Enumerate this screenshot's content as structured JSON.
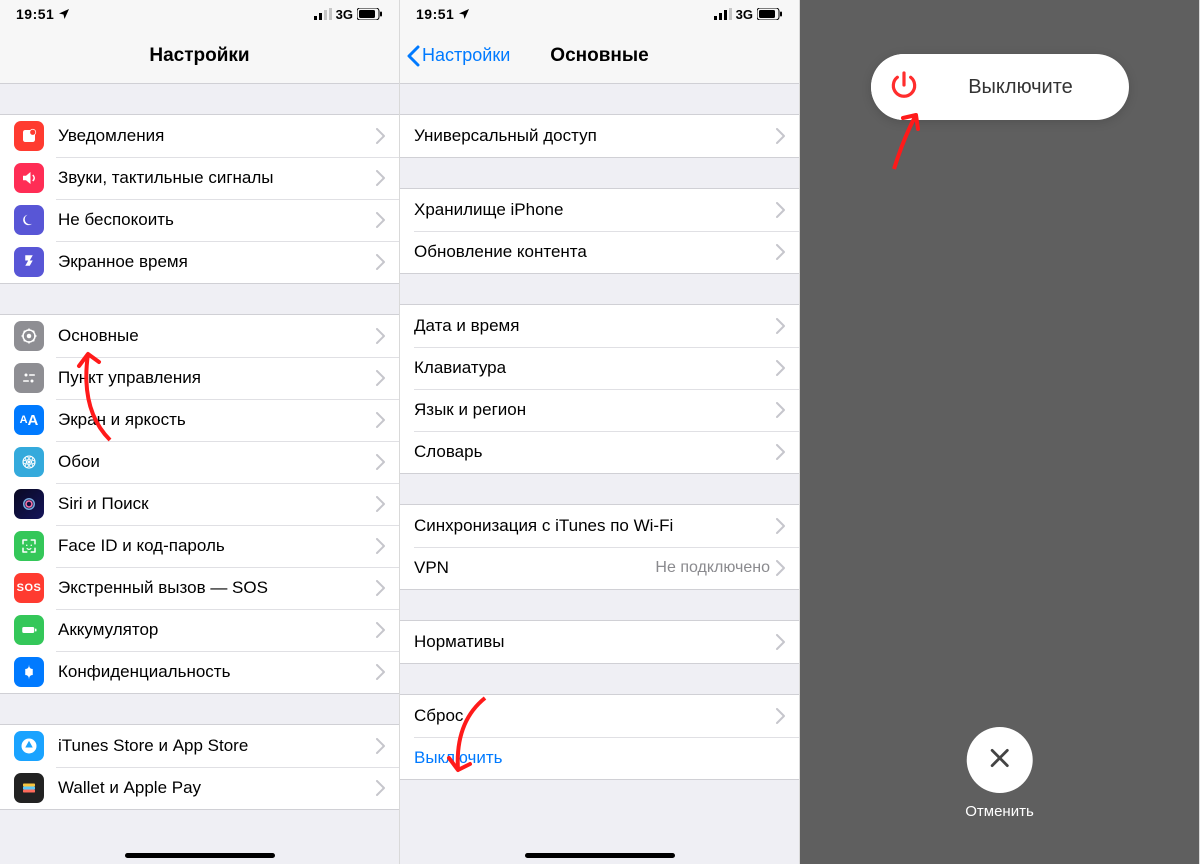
{
  "statusbar": {
    "time": "19:51",
    "network": "3G"
  },
  "screen1": {
    "title": "Настройки",
    "group_a": [
      {
        "icon": "notifications-icon",
        "color": "ic-red",
        "label": "Уведомления"
      },
      {
        "icon": "sounds-icon",
        "color": "ic-red2",
        "label": "Звуки, тактильные сигналы"
      },
      {
        "icon": "dnd-icon",
        "color": "ic-purple",
        "label": "Не беспокоить"
      },
      {
        "icon": "screentime-icon",
        "color": "ic-hourg",
        "label": "Экранное время"
      }
    ],
    "group_b": [
      {
        "icon": "general-icon",
        "color": "ic-gray",
        "label": "Основные"
      },
      {
        "icon": "controlcenter-icon",
        "color": "ic-gray2",
        "label": "Пункт управления"
      },
      {
        "icon": "display-icon",
        "color": "ic-blue",
        "label": "Экран и яркость"
      },
      {
        "icon": "wallpaper-icon",
        "color": "ic-cyan",
        "label": "Обои"
      },
      {
        "icon": "siri-icon",
        "color": "ic-siri",
        "label": "Siri и Поиск"
      },
      {
        "icon": "faceid-icon",
        "color": "ic-green",
        "label": "Face ID и код-пароль"
      },
      {
        "icon": "sos-icon",
        "color": "ic-sos",
        "label": "Экстренный вызов — SOS"
      },
      {
        "icon": "battery-icon",
        "color": "ic-green2",
        "label": "Аккумулятор"
      },
      {
        "icon": "privacy-icon",
        "color": "ic-hand",
        "label": "Конфиденциальность"
      }
    ],
    "group_c": [
      {
        "icon": "appstore-icon",
        "color": "ic-appst",
        "label": "iTunes Store и App Store"
      },
      {
        "icon": "wallet-icon",
        "color": "ic-wallet",
        "label": "Wallet и Apple Pay"
      }
    ]
  },
  "screen2": {
    "back": "Настройки",
    "title": "Основные",
    "group_a": [
      {
        "label": "Универсальный доступ"
      }
    ],
    "group_b": [
      {
        "label": "Хранилище iPhone"
      },
      {
        "label": "Обновление контента"
      }
    ],
    "group_c": [
      {
        "label": "Дата и время"
      },
      {
        "label": "Клавиатура"
      },
      {
        "label": "Язык и регион"
      },
      {
        "label": "Словарь"
      }
    ],
    "group_d": [
      {
        "label": "Синхронизация с iTunes по Wi-Fi"
      },
      {
        "label": "VPN",
        "value": "Не подключено"
      }
    ],
    "group_e": [
      {
        "label": "Нормативы"
      }
    ],
    "group_f": [
      {
        "label": "Сброс"
      },
      {
        "label": "Выключить",
        "link": true,
        "no_chevron": true
      }
    ]
  },
  "screen3": {
    "power_text": "Выключите",
    "cancel": "Отменить"
  }
}
